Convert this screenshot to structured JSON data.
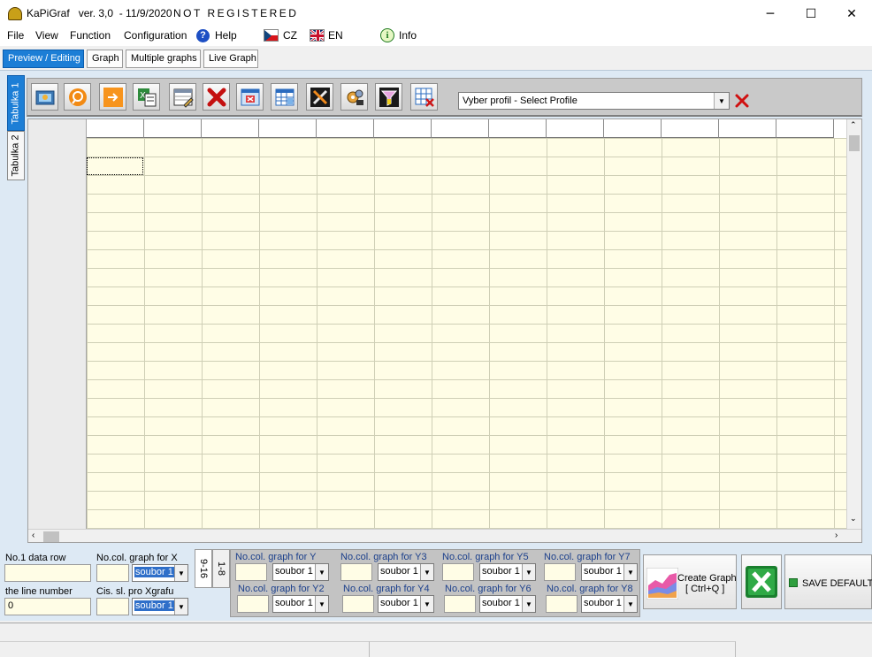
{
  "window": {
    "title": "KaPiGraf   ver. 3,0  - 11/9/2020",
    "registration": "NOT REGISTERED",
    "controls": {
      "minimize": "─",
      "maximize": "☐",
      "close": "✕"
    }
  },
  "menu": {
    "file": "File",
    "view": "View",
    "function": "Function",
    "configuration": "Configuration",
    "help": "Help",
    "cz": "CZ",
    "en": "EN",
    "info": "Info"
  },
  "tabs": {
    "preview": "Preview / Editing",
    "graph": "Graph",
    "multiple": "Multiple graphs",
    "live": "Live Graph"
  },
  "sheet_tabs": {
    "tab1": "Tabulka 1",
    "tab2": "Tabulka 2"
  },
  "toolbar_icons": [
    "open-file-icon",
    "search-icon",
    "arrow-right-icon",
    "excel-import-icon",
    "edit-table-icon",
    "delete-icon",
    "clear-table-icon",
    "table-grid-icon",
    "tools-icon",
    "settings-icon",
    "filter-icon",
    "grid-delete-icon"
  ],
  "profile": {
    "placeholder": "Vyber profil - Select Profile"
  },
  "grid": {
    "columns": 13,
    "rows": 21
  },
  "bottom": {
    "data_row_label": "No.1 data row",
    "data_row_value": "",
    "line_number_label": "the line number",
    "line_number_value": "0",
    "x_col_label": "No.col. graph for X",
    "x_col_value": "",
    "x_file": "soubor 1",
    "x_cis_label": "Cis. sl. pro Xgrafu",
    "x_cis_value": "",
    "x_cis_file": "soubor 1",
    "range_tab_a": "9-16",
    "range_tab_b": "1-8",
    "y_labels": [
      "No.col. graph for Y",
      "No.col. graph for Y2",
      "No.col. graph for Y3",
      "No.col. graph for Y4",
      "No.col. graph for Y5",
      "No.col. graph for Y6",
      "No.col. graph for Y7",
      "No.col. graph for Y8"
    ],
    "y_file": "soubor 1",
    "create_graph_line1": "Create Graph",
    "create_graph_line2": "[ Ctrl+Q ]",
    "save_default": "SAVE DEFAULT"
  },
  "colors": {
    "accent": "#1c7ed6",
    "cell_bg": "#fffde6",
    "panel_bg": "#dde9f4"
  }
}
